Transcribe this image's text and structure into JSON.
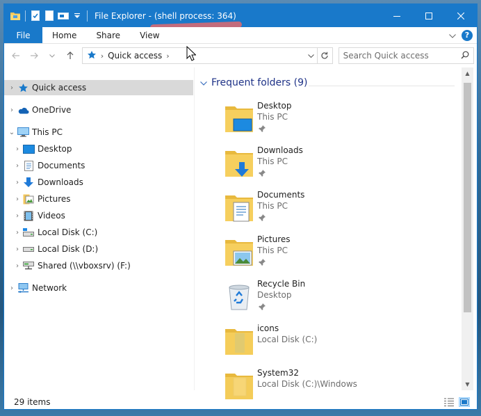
{
  "window": {
    "title": "File Explorer - (shell process: 364)",
    "accent": "#1979ca"
  },
  "ribbon": {
    "file": "File",
    "tabs": [
      "Home",
      "Share",
      "View"
    ]
  },
  "address": {
    "location": "Quick access",
    "search_placeholder": "Search Quick access"
  },
  "navpane": {
    "items": [
      {
        "label": "Quick access",
        "icon": "star-icon",
        "selected": true
      },
      {
        "label": "OneDrive",
        "icon": "cloud-icon"
      },
      {
        "label": "This PC",
        "icon": "computer-icon",
        "expanded": true
      },
      {
        "label": "Desktop",
        "icon": "desktop-icon"
      },
      {
        "label": "Documents",
        "icon": "documents-icon"
      },
      {
        "label": "Downloads",
        "icon": "downloads-icon"
      },
      {
        "label": "Pictures",
        "icon": "pictures-icon"
      },
      {
        "label": "Videos",
        "icon": "videos-icon"
      },
      {
        "label": "Local Disk (C:)",
        "icon": "drive-icon"
      },
      {
        "label": "Local Disk (D:)",
        "icon": "drive-icon"
      },
      {
        "label": "Shared (\\\\vboxsrv) (F:)",
        "icon": "network-drive-icon"
      },
      {
        "label": "Network",
        "icon": "network-icon"
      }
    ]
  },
  "content": {
    "group_title": "Frequent folders (9)",
    "folders": [
      {
        "name": "Desktop",
        "location": "This PC",
        "pinned": true,
        "icon": "desktop-folder-icon"
      },
      {
        "name": "Downloads",
        "location": "This PC",
        "pinned": true,
        "icon": "downloads-folder-icon"
      },
      {
        "name": "Documents",
        "location": "This PC",
        "pinned": true,
        "icon": "documents-folder-icon"
      },
      {
        "name": "Pictures",
        "location": "This PC",
        "pinned": true,
        "icon": "pictures-folder-icon"
      },
      {
        "name": "Recycle Bin",
        "location": "Desktop",
        "pinned": true,
        "icon": "recycle-bin-icon"
      },
      {
        "name": "icons",
        "location": "Local Disk (C:)",
        "pinned": false,
        "icon": "folder-icon"
      },
      {
        "name": "System32",
        "location": "Local Disk (C:)\\Windows",
        "pinned": false,
        "icon": "folder-icon"
      }
    ]
  },
  "status": {
    "items_count": "29 items"
  }
}
